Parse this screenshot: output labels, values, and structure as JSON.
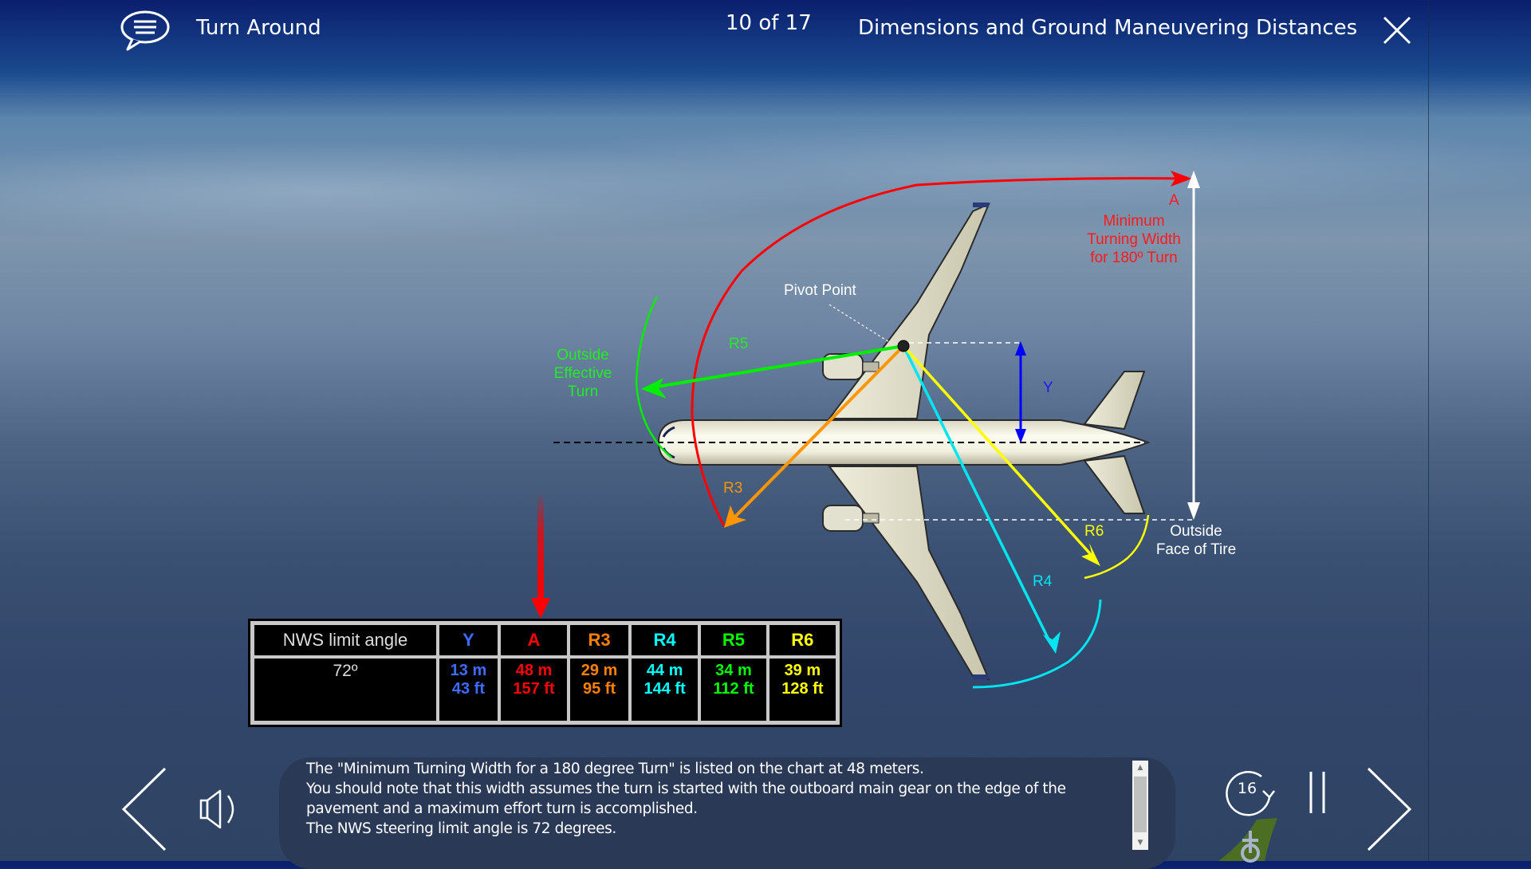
{
  "header": {
    "lesson_title": "Turn Around",
    "page_counter": "10 of 17",
    "section_title": "Dimensions and Ground Maneuvering Distances",
    "icons": {
      "transcript": "speech-bubble-icon",
      "close": "close-icon"
    }
  },
  "diagram": {
    "labels": {
      "a_letter": "A",
      "a_desc": [
        "Minimum",
        "Turning Width",
        "for 180º Turn"
      ],
      "pivot_point": "Pivot Point",
      "r5": "R5",
      "outside_effective_turn": [
        "Outside",
        "Effective",
        "Turn"
      ],
      "y": "Y",
      "r3": "R3",
      "r6": "R6",
      "r4": "R4",
      "outside_face_of_tire": [
        "Outside",
        "Face of Tire"
      ]
    },
    "colors": {
      "A": "#ff0000",
      "Y": "#0000ff",
      "R3": "#ff8c00",
      "R4": "#00e5f0",
      "R5": "#00ee00",
      "R6": "#ffff00",
      "white": "#ffffff"
    }
  },
  "table": {
    "row_header": "NWS limit angle",
    "row_value": "72º",
    "columns": [
      {
        "key": "Y",
        "label": "Y",
        "m": "13 m",
        "ft": "43 ft",
        "color": "#3d6bff"
      },
      {
        "key": "A",
        "label": "A",
        "m": "48 m",
        "ft": "157 ft",
        "color": "#ff0000"
      },
      {
        "key": "R3",
        "label": "R3",
        "m": "29 m",
        "ft": "95 ft",
        "color": "#ff8000"
      },
      {
        "key": "R4",
        "label": "R4",
        "m": "44 m",
        "ft": "144 ft",
        "color": "#00ffff"
      },
      {
        "key": "R5",
        "label": "R5",
        "m": "34 m",
        "ft": "112 ft",
        "color": "#00ff00"
      },
      {
        "key": "R6",
        "label": "R6",
        "m": "39 m",
        "ft": "128 ft",
        "color": "#ffff00"
      }
    ]
  },
  "narration": {
    "lines": [
      "The \"Minimum Turning Width for a 180 degree Turn\" is listed on the chart at 48 meters.",
      "You should note that this width assumes the turn is started with the outboard main gear on the edge of the",
      "pavement and a maximum effort turn is accomplished.",
      "The NWS steering limit angle is 72 degrees."
    ]
  },
  "controls": {
    "replay_seconds": "16",
    "icons": {
      "prev": "chevron-left-icon",
      "audio": "speaker-icon",
      "replay": "replay-icon",
      "pause": "pause-icon",
      "next": "chevron-right-icon"
    }
  }
}
